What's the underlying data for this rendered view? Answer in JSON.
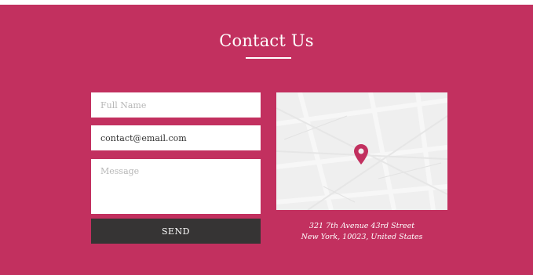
{
  "section": {
    "title": "Contact Us"
  },
  "form": {
    "name_placeholder": "Full Name",
    "email_value": "contact@email.com",
    "message_placeholder": "Message",
    "send_label": "SEND"
  },
  "address": {
    "line1": "321 7th Avenue 43rd Street",
    "line2": "New York, 10023, United States"
  },
  "map": {
    "pin_icon": "map-pin-icon",
    "pin_color": "#c2305f"
  },
  "colors": {
    "background": "#c2305f",
    "button": "#363434"
  }
}
